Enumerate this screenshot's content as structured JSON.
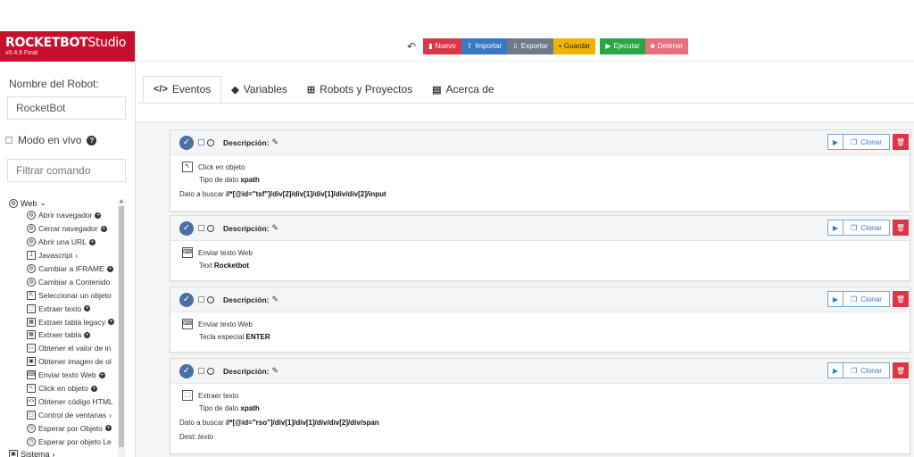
{
  "brand": {
    "name_bold": "ROCKETBOT",
    "name_light": "Studio",
    "version": "v0.4.9 Final"
  },
  "sidebar": {
    "robot_label": "Nombre del Robot:",
    "robot_value": "RocketBot",
    "live_mode_label": "Modo en vivo",
    "filter_placeholder": "Filtrar comando",
    "group_web": "Web",
    "items": [
      {
        "label": "Abrir navegador",
        "icon": "globe-icon"
      },
      {
        "label": "Cerrar navegador",
        "icon": "globe-icon"
      },
      {
        "label": "Abrir una URL",
        "icon": "globe-icon"
      },
      {
        "label": "Javascript",
        "icon": "js-file-icon"
      },
      {
        "label": "Cambiar a IFRAME",
        "icon": "globe-icon"
      },
      {
        "label": "Cambiar a Contenido",
        "icon": "globe-icon"
      },
      {
        "label": "Seleccionar un objeto",
        "icon": "select-icon"
      },
      {
        "label": "Extraer texto",
        "icon": "extract-icon"
      },
      {
        "label": "Extraer tabla legacy",
        "icon": "table-icon"
      },
      {
        "label": "Extraer tabla",
        "icon": "table-icon"
      },
      {
        "label": "Obtener el valor de in",
        "icon": "input-icon"
      },
      {
        "label": "Obtener imagen de ol",
        "icon": "image-icon"
      },
      {
        "label": "Enviar texto Web",
        "icon": "keyboard-icon"
      },
      {
        "label": "Click en objeto",
        "icon": "click-icon"
      },
      {
        "label": "Obtener código HTML",
        "icon": "code-icon"
      },
      {
        "label": "Control de ventanas",
        "icon": "window-icon"
      },
      {
        "label": "Esperar por Objeto",
        "icon": "timer-icon"
      },
      {
        "label": "Esperar por objeto Le",
        "icon": "timer-icon"
      }
    ],
    "group_sistema": "Sistema"
  },
  "toolbar": {
    "nuevo": "Nuevo",
    "importar": "Importar",
    "exportar": "Exportar",
    "guardar": "Guardar",
    "ejecutar": "Ejecutar",
    "detener": "Detener",
    "colors": {
      "nuevo": "#dc3545",
      "importar": "#3a78c3",
      "exportar": "#6c7a89",
      "guardar": "#f0b400",
      "ejecutar": "#28a745",
      "detener": "#e8707e"
    }
  },
  "tabs": [
    {
      "label": "Eventos",
      "icon": "code-icon"
    },
    {
      "label": "Variables",
      "icon": "tags-icon"
    },
    {
      "label": "Robots y Proyectos",
      "icon": "sitemap-icon"
    },
    {
      "label": "Acerca de",
      "icon": "id-card-icon"
    }
  ],
  "cards": [
    {
      "desc": "Descripción:",
      "clone": "Clonar",
      "command": "Click en objeto",
      "line1_label": "Tipo de dato",
      "line1_value": "xpath",
      "line2_label": "Dato a buscar",
      "line2_value": "//*[@id=\"tsf\"]/div[2]/div[1]/div[1]/div/div[2]/input"
    },
    {
      "desc": "Descripción:",
      "clone": "Clonar",
      "command": "Enviar texto Web",
      "line1_label": "Text",
      "line1_value": "Rocketbot"
    },
    {
      "desc": "Descripción:",
      "clone": "Clonar",
      "command": "Enviar texto Web",
      "line1_label": "Tecla especial",
      "line1_value": "ENTER"
    },
    {
      "desc": "Descripción:",
      "clone": "Clonar",
      "command": "Extraer texto",
      "line1_label": "Tipo de dato",
      "line1_value": "xpath",
      "line2_label": "Dato a buscar",
      "line2_value": "//*[@id=\"rso\"]/div[1]/div[1]/div/div[2]/div/span",
      "line3_label": "Dest:",
      "line3_value": "texto"
    }
  ]
}
